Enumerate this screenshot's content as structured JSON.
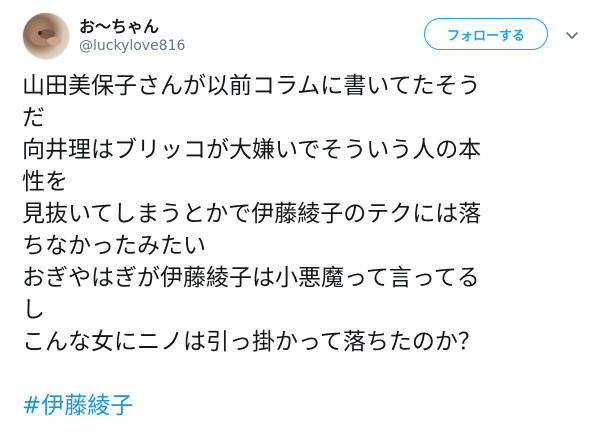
{
  "user": {
    "display_name": "お〜ちゃん",
    "handle": "@luckylove816"
  },
  "header": {
    "follow_label": "フォローする"
  },
  "tweet": {
    "lines": [
      "山田美保子さんが以前コラムに書いてたそう",
      "だ",
      "向井理はブリッコが大嫌いでそういう人の本",
      "性を",
      "見抜いてしまうとかで伊藤綾子のテクには落",
      "ちなかったみたい",
      "おぎやはぎが伊藤綾子は小悪魔って言ってる",
      "し",
      "こんな女にニノは引っ掛かって落ちたのか？"
    ],
    "hashtag": "#伊藤綾子"
  },
  "icons": {
    "menu": "chevron-down-icon",
    "avatar": "avatar-image"
  },
  "colors": {
    "accent": "#1da1f2",
    "hashtag": "#1b95e0",
    "text": "#14171a",
    "secondary": "#657786"
  }
}
